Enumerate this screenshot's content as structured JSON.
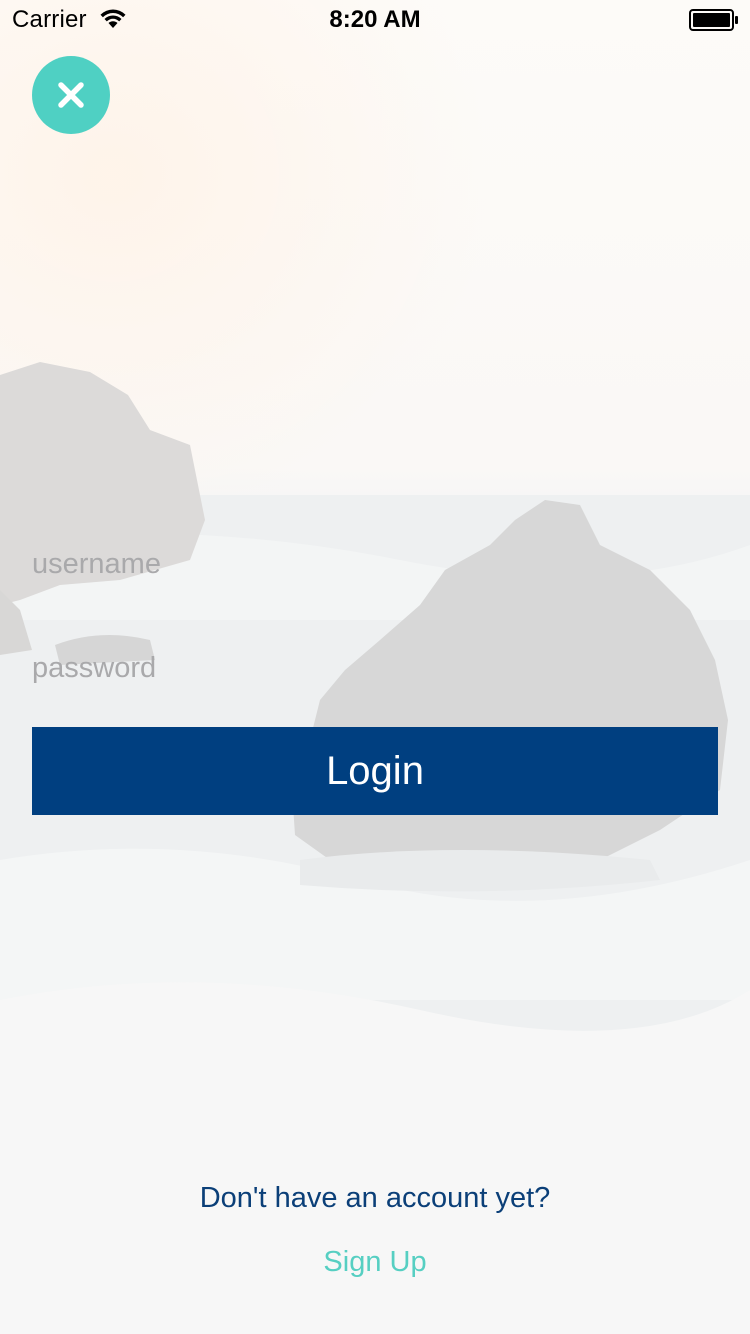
{
  "status_bar": {
    "carrier": "Carrier",
    "time": "8:20 AM",
    "wifi_icon": "wifi-icon",
    "battery_icon": "battery-icon"
  },
  "close_button": {
    "icon": "close-icon",
    "color": "#4fd0c3"
  },
  "form": {
    "username_placeholder": "username",
    "username_value": "",
    "password_placeholder": "password",
    "password_value": "",
    "login_label": "Login",
    "login_color": "#003f80"
  },
  "footer": {
    "prompt_text": "Don't have an account yet?",
    "signup_label": "Sign Up",
    "prompt_color": "#0b3f78",
    "signup_color": "#56cfc2"
  }
}
